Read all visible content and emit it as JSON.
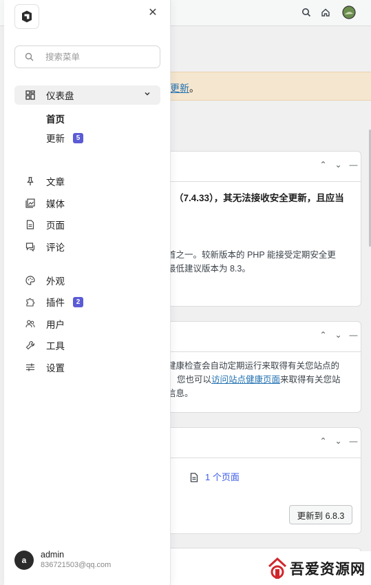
{
  "background": {
    "notice_link": "更新",
    "notice_suffix": "。",
    "php_card": {
      "line1": "（7.4.33），其无法接收安全更新，且应当",
      "line2": "首之一。较新版本的 PHP 能接受定期安全更",
      "line3": "最低建议版本为 8.3。"
    },
    "health_card": {
      "line1": "健康检查会自动定期运行来取得有关您站点的",
      "line2_prefix": "您也可以",
      "line2_link": "访问站点健康页面",
      "line2_suffix": "来取得有关您站",
      "line3": "信息。"
    },
    "pages_card": {
      "page_link": "1 个页面",
      "update_button": "更新到 6.8.3",
      "trailing": "。"
    },
    "controls": {
      "up": "⌃",
      "down": "⌄",
      "collapse": "—"
    }
  },
  "drawer": {
    "close": "✕",
    "search_placeholder": "搜索菜单",
    "dashboard": {
      "label": "仪表盘",
      "children": [
        {
          "label": "首页",
          "current": true
        },
        {
          "label": "更新",
          "badge": "5"
        }
      ]
    },
    "menu": [
      {
        "label": "文章",
        "icon": "pin-icon"
      },
      {
        "label": "媒体",
        "icon": "media-icon"
      },
      {
        "label": "页面",
        "icon": "page-icon"
      },
      {
        "label": "评论",
        "icon": "comment-icon"
      },
      {
        "label": "外观",
        "icon": "palette-icon"
      },
      {
        "label": "插件",
        "icon": "plugin-icon",
        "badge": "2"
      },
      {
        "label": "用户",
        "icon": "users-icon"
      },
      {
        "label": "工具",
        "icon": "wrench-icon"
      },
      {
        "label": "设置",
        "icon": "settings-icon"
      }
    ],
    "user": {
      "avatar_letter": "a",
      "name": "admin",
      "email": "836721503@qq.com"
    }
  },
  "watermark": {
    "text": "吾爱资源网"
  }
}
